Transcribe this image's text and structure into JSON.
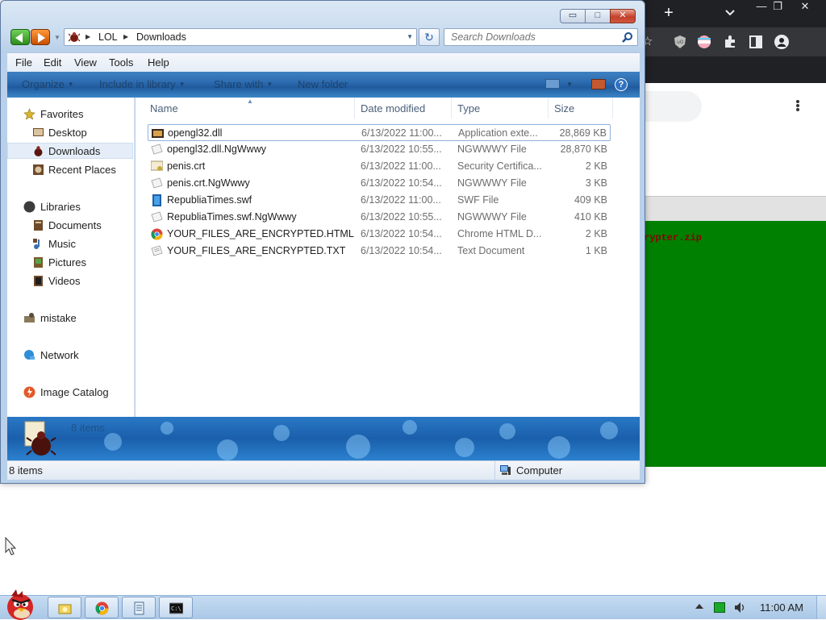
{
  "colors": {
    "accent": "#2d6cb0",
    "chrome_dark": "#202124",
    "green_panel": "#008000",
    "selection": "#e5eef8",
    "close_red": "#c4402a"
  },
  "chrome": {
    "new_tab": "+",
    "tab_list": "⌄",
    "window_buttons": [
      "—",
      "❐",
      "✕"
    ],
    "partial_text": "rypter.zip",
    "star": "☆"
  },
  "explorer": {
    "title_buttons": {
      "minimize": "▭",
      "maximize": "□",
      "close": "✕"
    },
    "breadcrumb": [
      "LOL",
      "Downloads"
    ],
    "search_placeholder": "Search Downloads",
    "menu": [
      "File",
      "Edit",
      "View",
      "Tools",
      "Help"
    ],
    "commands": [
      {
        "label": "Organize",
        "dropdown": true
      },
      {
        "label": "Include in library",
        "dropdown": true
      },
      {
        "label": "Share with",
        "dropdown": true
      },
      {
        "label": "New folder",
        "dropdown": false
      }
    ],
    "help_label": "?",
    "nav": {
      "favorites": {
        "label": "Favorites",
        "items": [
          "Desktop",
          "Downloads",
          "Recent Places"
        ]
      },
      "libraries": {
        "label": "Libraries",
        "items": [
          "Documents",
          "Music",
          "Pictures",
          "Videos"
        ]
      },
      "others": [
        "mistake",
        "Network",
        "Image Catalog"
      ]
    },
    "columns": [
      "Name",
      "Date modified",
      "Type",
      "Size"
    ],
    "files": [
      {
        "name": "opengl32.dll",
        "date": "6/13/2022 11:00...",
        "type": "Application exte...",
        "size": "28,869 KB",
        "icon": "dll-icon"
      },
      {
        "name": "opengl32.dll.NgWwwy",
        "date": "6/13/2022 10:55...",
        "type": "NGWWWY File",
        "size": "28,870 KB",
        "icon": "blank-file-icon"
      },
      {
        "name": "penis.crt",
        "date": "6/13/2022 11:00...",
        "type": "Security Certifica...",
        "size": "2 KB",
        "icon": "certificate-icon"
      },
      {
        "name": "penis.crt.NgWwwy",
        "date": "6/13/2022 10:54...",
        "type": "NGWWWY File",
        "size": "3 KB",
        "icon": "blank-file-icon"
      },
      {
        "name": "RepubliaTimes.swf",
        "date": "6/13/2022 11:00...",
        "type": "SWF File",
        "size": "409 KB",
        "icon": "swf-icon"
      },
      {
        "name": "RepubliaTimes.swf.NgWwwy",
        "date": "6/13/2022 10:55...",
        "type": "NGWWWY File",
        "size": "410 KB",
        "icon": "blank-file-icon"
      },
      {
        "name": "YOUR_FILES_ARE_ENCRYPTED.HTML",
        "date": "6/13/2022 10:54...",
        "type": "Chrome HTML D...",
        "size": "2 KB",
        "icon": "chrome-html-icon"
      },
      {
        "name": "YOUR_FILES_ARE_ENCRYPTED.TXT",
        "date": "6/13/2022 10:54...",
        "type": "Text Document",
        "size": "1 KB",
        "icon": "text-file-icon"
      }
    ],
    "details_count": "8 items",
    "status_left": "8 items",
    "status_right": "Computer"
  },
  "taskbar": {
    "clock": "11:00 AM",
    "buttons": [
      "explorer-icon",
      "chrome-icon",
      "notepad-icon",
      "cmd-icon"
    ]
  }
}
